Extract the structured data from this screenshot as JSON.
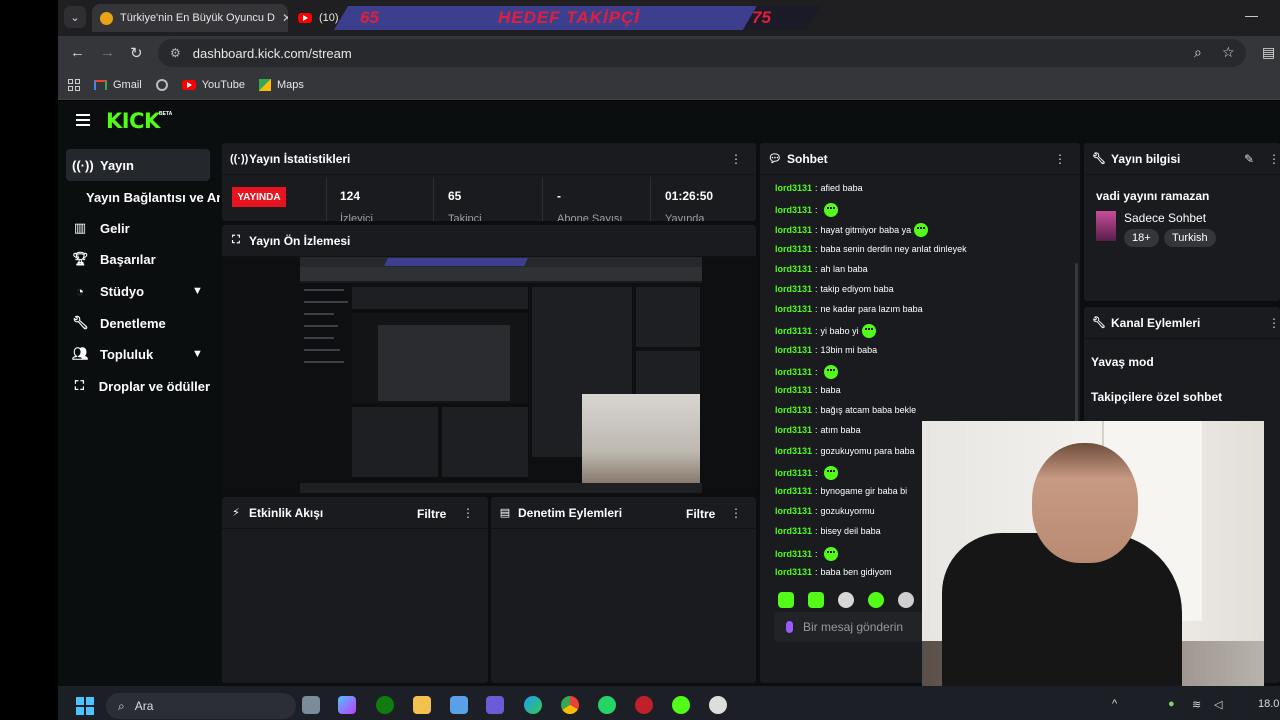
{
  "browser": {
    "tabs": [
      {
        "title": "Türkiye'nin En Büyük Oyuncu D"
      },
      {
        "title": "(10)"
      }
    ],
    "url": "dashboard.kick.com/stream",
    "bookmarks": [
      {
        "label": "Gmail",
        "icon": "gmail-icon"
      },
      {
        "label": "",
        "icon": "globe-icon"
      },
      {
        "label": "YouTube",
        "icon": "youtube-icon"
      },
      {
        "label": "Maps",
        "icon": "maps-icon"
      }
    ]
  },
  "overlay_goal": {
    "current": "65",
    "label": "HEDEF TAKİPÇİ",
    "target": "75",
    "progress_fraction": 0.87,
    "color": "#e0203a"
  },
  "brand": {
    "logo": "KICK",
    "badge": "BETA",
    "accent": "#53fc18"
  },
  "sidebar": {
    "items": [
      {
        "label": "Yayın",
        "icon": "broadcast-icon",
        "active": true
      },
      {
        "label": "Yayın Bağlantısı ve Anahtarı",
        "icon": ""
      },
      {
        "label": "Gelir",
        "icon": "chart-icon"
      },
      {
        "label": "Başarılar",
        "icon": "trophy-icon"
      },
      {
        "label": "Stüdyo",
        "icon": "palette-icon"
      },
      {
        "label": "Denetleme",
        "icon": "wrench-icon"
      },
      {
        "label": "Topluluk",
        "icon": "users-icon"
      },
      {
        "label": "Droplar ve ödüller",
        "icon": "gift-icon"
      }
    ]
  },
  "stats_panel": {
    "title": "Yayın İstatistikleri",
    "badge": "YAYINDA",
    "stats": [
      {
        "value": "124",
        "label": "İzleyici"
      },
      {
        "value": "65",
        "label": "Takipçi"
      },
      {
        "value": "-",
        "label": "Abone Sayısı"
      },
      {
        "value": "01:26:50",
        "label": "Yayında"
      }
    ]
  },
  "preview_panel": {
    "title": "Yayın Ön İzlemesi"
  },
  "activity_panel": {
    "title": "Etkinlik Akışı",
    "filter": "Filtre"
  },
  "moderation_panel": {
    "title": "Denetim Eylemleri",
    "filter": "Filtre"
  },
  "chat": {
    "title": "Sohbet",
    "messages": [
      {
        "user": "lord3131",
        "text": "afied baba",
        "emote": false
      },
      {
        "user": "lord3131",
        "text": "",
        "emote": true
      },
      {
        "user": "lord3131",
        "text": "hayat gitmiyor baba ya",
        "emote": true
      },
      {
        "user": "lord3131",
        "text": "baba senin derdin ney anlat dinleyek",
        "emote": false
      },
      {
        "user": "lord3131",
        "text": "ah lan baba",
        "emote": false
      },
      {
        "user": "lord3131",
        "text": "takip ediyom baba",
        "emote": false
      },
      {
        "user": "lord3131",
        "text": "ne kadar para lazım baba",
        "emote": false
      },
      {
        "user": "lord3131",
        "text": "yi babo yi",
        "emote": true
      },
      {
        "user": "lord3131",
        "text": "13bin mi baba",
        "emote": false
      },
      {
        "user": "lord3131",
        "text": "",
        "emote": true
      },
      {
        "user": "lord3131",
        "text": "baba",
        "emote": false
      },
      {
        "user": "lord3131",
        "text": "bağış atcam baba bekle",
        "emote": false
      },
      {
        "user": "lord3131",
        "text": "atım baba",
        "emote": false
      },
      {
        "user": "lord3131",
        "text": "gozukuyomu para baba",
        "emote": false
      },
      {
        "user": "lord3131",
        "text": "",
        "emote": true
      },
      {
        "user": "lord3131",
        "text": "bynogame gir baba bi",
        "emote": false
      },
      {
        "user": "lord3131",
        "text": "gozukuyormu",
        "emote": false
      },
      {
        "user": "lord3131",
        "text": "bisey deil baba",
        "emote": false
      },
      {
        "user": "lord3131",
        "text": "",
        "emote": true
      },
      {
        "user": "lord3131",
        "text": "baba ben gidiyom",
        "emote": false
      }
    ],
    "input_placeholder": "Bir mesaj gönderin"
  },
  "stream_info": {
    "title": "Yayın bilgisi",
    "stream_title": "vadi yayını ramazan",
    "category": "Sadece Sohbet",
    "tags": [
      "18+",
      "Turkish"
    ]
  },
  "channel_actions": {
    "title": "Kanal Eylemleri",
    "items": [
      "Yavaş mod",
      "Takipçilere özel sohbet"
    ]
  },
  "taskbar": {
    "search": "Ara",
    "clock": "18.0"
  }
}
